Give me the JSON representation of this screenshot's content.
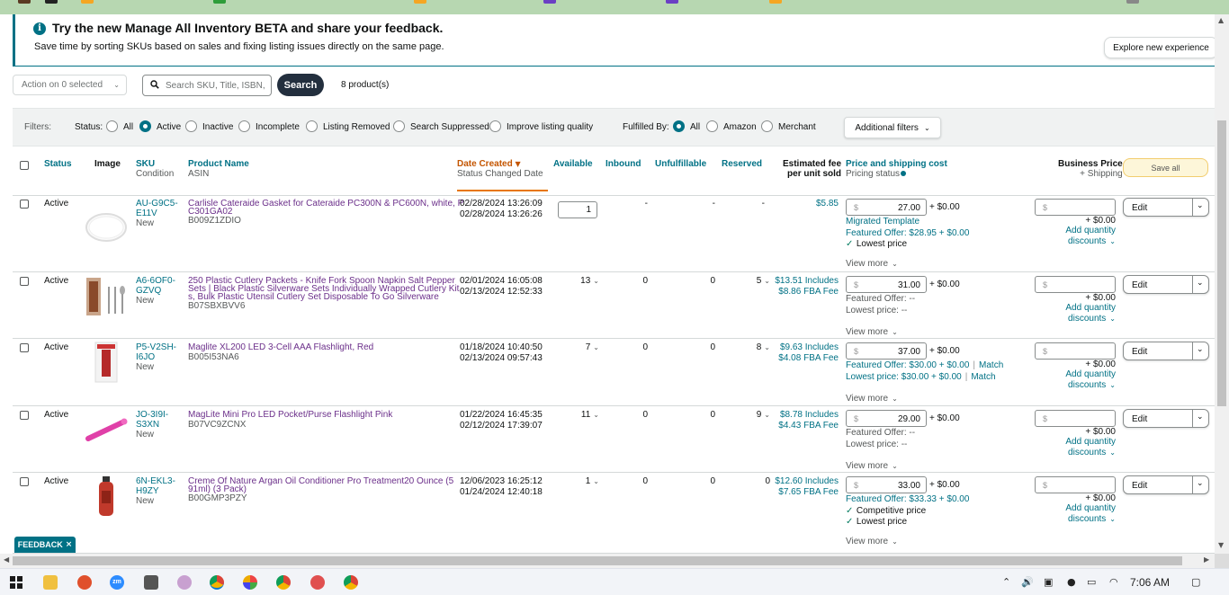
{
  "banner": {
    "title": "Try the new Manage All Inventory BETA and share your feedback.",
    "subtitle": "Save time by sorting SKUs based on sales and fixing listing issues directly on the same page.",
    "explore_button": "Explore new experience",
    "accent_color": "#007185"
  },
  "toolbar": {
    "action_label": "Action on 0 selected",
    "search_placeholder": "Search SKU, Title, ISBN, ASIN",
    "search_button": "Search",
    "product_count": "8 product(s)"
  },
  "filters": {
    "label": "Filters:",
    "status_label": "Status:",
    "status_options": [
      "All",
      "Active",
      "Inactive",
      "Incomplete",
      "Listing Removed",
      "Search Suppressed",
      "Improve listing quality"
    ],
    "status_selected": "Active",
    "fulfilled_label": "Fulfilled By:",
    "fulfilled_options": [
      "All",
      "Amazon",
      "Merchant"
    ],
    "fulfilled_selected": "All",
    "additional_button": "Additional filters"
  },
  "table": {
    "headers": {
      "status": "Status",
      "image": "Image",
      "sku": "SKU",
      "condition": "Condition",
      "product_name": "Product Name",
      "asin": "ASIN",
      "date_created": "Date Created",
      "status_changed": "Status Changed Date",
      "available": "Available",
      "inbound": "Inbound",
      "unfulfillable": "Unfulfillable",
      "reserved": "Reserved",
      "est_fee_1": "Estimated fee",
      "est_fee_2": "per unit sold",
      "price_shipping": "Price and shipping cost",
      "pricing_status": "Pricing status",
      "business_price": "Business Price",
      "business_shipping": "+ Shipping",
      "save_all": "Save all"
    },
    "rows": [
      {
        "status": "Active",
        "image": "round gasket",
        "sku_1": "AU-G9C5-",
        "sku_2": "E11V",
        "condition": "New",
        "name_1": "Carlisle Cateraide Gasket for Cateraide PC300N & PC600N, white, P",
        "name_2": "C301GA02",
        "asin": "B009Z1ZDIO",
        "date_created": "02/28/2024 13:26:09",
        "status_changed": "02/28/2024 13:26:26",
        "available": "1",
        "inbound": "-",
        "unfulfillable": "-",
        "reserved": "",
        "fee_1": "$5.85",
        "fee_2": "",
        "price": "27.00",
        "shipping": "+ $0.00",
        "lines": [
          {
            "text": "Migrated Template",
            "kind": "teal"
          },
          {
            "text": "Featured Offer: $28.95 + $0.00",
            "kind": "teal"
          },
          {
            "text": "Lowest price",
            "kind": "check"
          }
        ],
        "view_more": "View more",
        "bp_shipping": "+ $0.00",
        "add_qty_1": "Add quantity",
        "add_qty_2": "discounts",
        "edit": "Edit"
      },
      {
        "status": "Active",
        "image": "cutlery packet",
        "sku_1": "A6-6OF0-",
        "sku_2": "GZVQ",
        "condition": "New",
        "name_1": "250 Plastic Cutlery Packets - Knife Fork Spoon Napkin Salt Pepper",
        "name_2": "Sets | Black Plastic Silverware Sets Individually Wrapped Cutlery Kit",
        "name_3": "s, Bulk Plastic Utensil Cutlery Set Disposable To Go Silverware",
        "asin": "B07SBXBVV6",
        "date_created": "02/01/2024 16:05:08",
        "status_changed": "02/13/2024 12:52:33",
        "available": "13",
        "inbound": "0",
        "unfulfillable": "0",
        "reserved": "5",
        "fee_1": "$13.51 Includes",
        "fee_2": "$8.86 FBA Fee",
        "price": "31.00",
        "shipping": "+ $0.00",
        "lines": [
          {
            "text": "Featured Offer: --",
            "kind": "grey"
          },
          {
            "text": "Lowest price: --",
            "kind": "grey"
          }
        ],
        "view_more": "View more",
        "bp_shipping": "+ $0.00",
        "add_qty_1": "Add quantity",
        "add_qty_2": "discounts",
        "edit": "Edit"
      },
      {
        "status": "Active",
        "image": "flashlight red",
        "sku_1": "P5-V2SH-",
        "sku_2": "I6JO",
        "condition": "New",
        "name_1": "Maglite XL200 LED 3-Cell AAA Flashlight, Red",
        "asin": "B005I53NA6",
        "date_created": "01/18/2024 10:40:50",
        "status_changed": "02/13/2024 09:57:43",
        "available": "7",
        "inbound": "0",
        "unfulfillable": "0",
        "reserved": "8",
        "fee_1": "$9.63 Includes",
        "fee_2": "$4.08 FBA Fee",
        "price": "37.00",
        "shipping": "+ $0.00",
        "lines": [
          {
            "text": "Featured Offer: $30.00 + $0.00",
            "kind": "teal",
            "match": "Match"
          },
          {
            "text": "Lowest price: $30.00 + $0.00",
            "kind": "teal",
            "match": "Match"
          }
        ],
        "view_more": "View more",
        "bp_shipping": "+ $0.00",
        "add_qty_1": "Add quantity",
        "add_qty_2": "discounts",
        "edit": "Edit"
      },
      {
        "status": "Active",
        "image": "flashlight pink",
        "sku_1": "JO-3I9I-",
        "sku_2": "S3XN",
        "condition": "New",
        "name_1": "MagLite Mini Pro LED Pocket/Purse Flashlight Pink",
        "asin": "B07VC9ZCNX",
        "date_created": "01/22/2024 16:45:35",
        "status_changed": "02/12/2024 17:39:07",
        "available": "11",
        "inbound": "0",
        "unfulfillable": "0",
        "reserved": "9",
        "fee_1": "$8.78 Includes",
        "fee_2": "$4.43 FBA Fee",
        "price": "29.00",
        "shipping": "+ $0.00",
        "lines": [
          {
            "text": "Featured Offer: --",
            "kind": "grey"
          },
          {
            "text": "Lowest price: --",
            "kind": "grey"
          }
        ],
        "view_more": "View more",
        "bp_shipping": "+ $0.00",
        "add_qty_1": "Add quantity",
        "add_qty_2": "discounts",
        "edit": "Edit"
      },
      {
        "status": "Active",
        "image": "conditioner bottle",
        "sku_1": "6N-EKL3-",
        "sku_2": "H9ZY",
        "condition": "New",
        "name_1": "Creme Of Nature Argan Oil Conditioner Pro Treatment20 Ounce (5",
        "name_2": "91ml) (3 Pack)",
        "asin": "B00GMP3PZY",
        "date_created": "12/06/2023 16:25:12",
        "status_changed": "01/24/2024 12:40:18",
        "available": "1",
        "inbound": "0",
        "unfulfillable": "0",
        "reserved": "0",
        "fee_1": "$12.60 Includes",
        "fee_2": "$7.65 FBA Fee",
        "price": "33.00",
        "shipping": "+ $0.00",
        "lines": [
          {
            "text": "Featured Offer: $33.33 + $0.00",
            "kind": "teal"
          },
          {
            "text": "Competitive price",
            "kind": "check"
          },
          {
            "text": "Lowest price",
            "kind": "check"
          }
        ],
        "view_more": "View more",
        "bp_shipping": "+ $0.00",
        "add_qty_1": "Add quantity",
        "add_qty_2": "discounts",
        "edit": "Edit"
      }
    ]
  },
  "feedback": "FEEDBACK",
  "taskbar": {
    "time": "7:06 AM"
  }
}
